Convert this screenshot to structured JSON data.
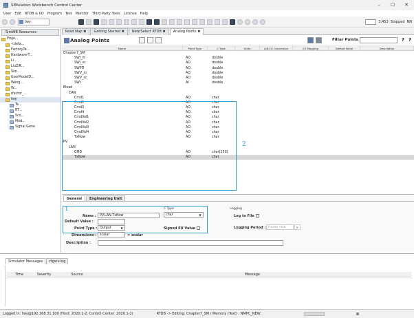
{
  "window": {
    "title": "SIMulation Workbench Control Center",
    "minimize": "–",
    "maximize": "☐",
    "close": "✕"
  },
  "menu": [
    "User",
    "Edit",
    "RTDB & I/O",
    "Program",
    "Test",
    "Monitor",
    "Third Party Tools",
    "License",
    "Help"
  ],
  "toolbar": {
    "project": "twy",
    "counter": "3,453",
    "state": "Stopped",
    "mode": "NN"
  },
  "left": {
    "tab": "SimWB Resources",
    "items": [
      {
        "label": "Proje...",
        "indent": 0,
        "kind": "root"
      },
      {
        "label": "<defa...",
        "indent": 1,
        "kind": "folder"
      },
      {
        "label": "FactoryTe...",
        "indent": 1,
        "kind": "folder"
      },
      {
        "label": "Hardware-T...",
        "indent": 1,
        "kind": "folder"
      },
      {
        "label": "Li...",
        "indent": 1,
        "kind": "folder"
      },
      {
        "label": "LiuZiR...",
        "indent": 1,
        "kind": "folder"
      },
      {
        "label": "Sim...",
        "indent": 1,
        "kind": "folder"
      },
      {
        "label": "UserModelD...",
        "indent": 1,
        "kind": "folder"
      },
      {
        "label": "Wang...",
        "indent": 1,
        "kind": "folder"
      },
      {
        "label": "W...",
        "indent": 1,
        "kind": "folder"
      },
      {
        "label": "rfactor_...",
        "indent": 1,
        "kind": "folder"
      },
      {
        "label": "twy",
        "indent": 1,
        "kind": "folder",
        "selected": true
      },
      {
        "label": "Te...",
        "indent": 2,
        "kind": "doc"
      },
      {
        "label": "RT...",
        "indent": 2,
        "kind": "doc"
      },
      {
        "label": "Sco...",
        "indent": 2,
        "kind": "doc"
      },
      {
        "label": "Mod...",
        "indent": 2,
        "kind": "doc"
      },
      {
        "label": "Signal Gene",
        "indent": 2,
        "kind": "doc"
      }
    ]
  },
  "tabs": [
    {
      "label": "Road Map ✖",
      "active": false
    },
    {
      "label": "Getting Started ✖",
      "active": false
    },
    {
      "label": "New/Select RTDB ✖",
      "active": false
    },
    {
      "label": "Analog Points ✖",
      "active": true
    }
  ],
  "analog_points": {
    "title": "Analog Points",
    "filter_label": "Filter Points",
    "help": "?",
    "columns": [
      "Name",
      "Point Type",
      "C Type",
      "Units",
      "A/B EU Conversion",
      "I/O Mapping",
      "Default Value",
      "Description"
    ],
    "rows": [
      {
        "name": "Chapter7_SM",
        "indent": 0,
        "type": "",
        "ctype": ""
      },
      {
        "name": "SWI_m",
        "indent": 2,
        "type": "AO",
        "ctype": "double"
      },
      {
        "name": "SWI_sc",
        "indent": 2,
        "type": "AO",
        "ctype": "double"
      },
      {
        "name": "SWPD",
        "indent": 2,
        "type": "AO",
        "ctype": "double"
      },
      {
        "name": "SWV_m",
        "indent": 2,
        "type": "AO",
        "ctype": "double"
      },
      {
        "name": "SWV_sc",
        "indent": 2,
        "type": "AO",
        "ctype": "double"
      },
      {
        "name": "SWt",
        "indent": 2,
        "type": "AI",
        "ctype": "double"
      },
      {
        "name": "Elead",
        "indent": 0,
        "type": "",
        "ctype": ""
      },
      {
        "name": "CAN",
        "indent": 1,
        "type": "",
        "ctype": ""
      },
      {
        "name": "Cmd1",
        "indent": 2,
        "type": "AO",
        "ctype": "char"
      },
      {
        "name": "Cmd2",
        "indent": 2,
        "type": "AO",
        "ctype": "char"
      },
      {
        "name": "Cmd3",
        "indent": 2,
        "type": "AO",
        "ctype": "char"
      },
      {
        "name": "Cmd4",
        "indent": 2,
        "type": "AO",
        "ctype": "char"
      },
      {
        "name": "CmdVal1",
        "indent": 2,
        "type": "AO",
        "ctype": "char"
      },
      {
        "name": "CmdVal2",
        "indent": 2,
        "type": "AO",
        "ctype": "char"
      },
      {
        "name": "CmdVal3",
        "indent": 2,
        "type": "AO",
        "ctype": "char"
      },
      {
        "name": "CmdVal4",
        "indent": 2,
        "type": "AO",
        "ctype": "char"
      },
      {
        "name": "TxNow",
        "indent": 2,
        "type": "AO",
        "ctype": "char"
      },
      {
        "name": "PV",
        "indent": 0,
        "type": "",
        "ctype": ""
      },
      {
        "name": "LAN",
        "indent": 1,
        "type": "",
        "ctype": ""
      },
      {
        "name": "CMD",
        "indent": 2,
        "type": "AO",
        "ctype": "char[250]"
      },
      {
        "name": "TxNow",
        "indent": 2,
        "type": "AO",
        "ctype": "char",
        "selected": true
      }
    ]
  },
  "callouts": {
    "one": "1",
    "two": "2",
    "color": "#2f9fd0"
  },
  "props": {
    "tabs": [
      "General",
      "Engineering Unit"
    ],
    "name_label": "Name :",
    "name_value": "PV.LAN.TxNow",
    "default_label": "Default Value :",
    "point_type_label": "Point Type :",
    "point_type_value": "Output",
    "dimensions_label": "Dimensions :",
    "dimensions_value": "scalar",
    "dimensions_note": "= scalar",
    "description_label": "Description :",
    "ctype_label": "C Type",
    "ctype_value": "char",
    "signed_label": "Signed EU Value",
    "logging_label": "Logging",
    "log_to_file_label": "Log to File",
    "logging_period_label": "Logging Period :",
    "logging_period_value": "frame rate"
  },
  "messages": {
    "tabs": [
      "Simulator Messages",
      "cfgsrv.log"
    ],
    "columns": [
      "Time",
      "Severity",
      "Source",
      "Message"
    ]
  },
  "status": {
    "login": "Logged In: twy@192.168.31.100 (Host: 2020.1-2, Control Center: 2020.1-2)",
    "editing": "RTDB -> Editing: Chapter7_SM / Memory (Text) : NMPC_NEW"
  }
}
